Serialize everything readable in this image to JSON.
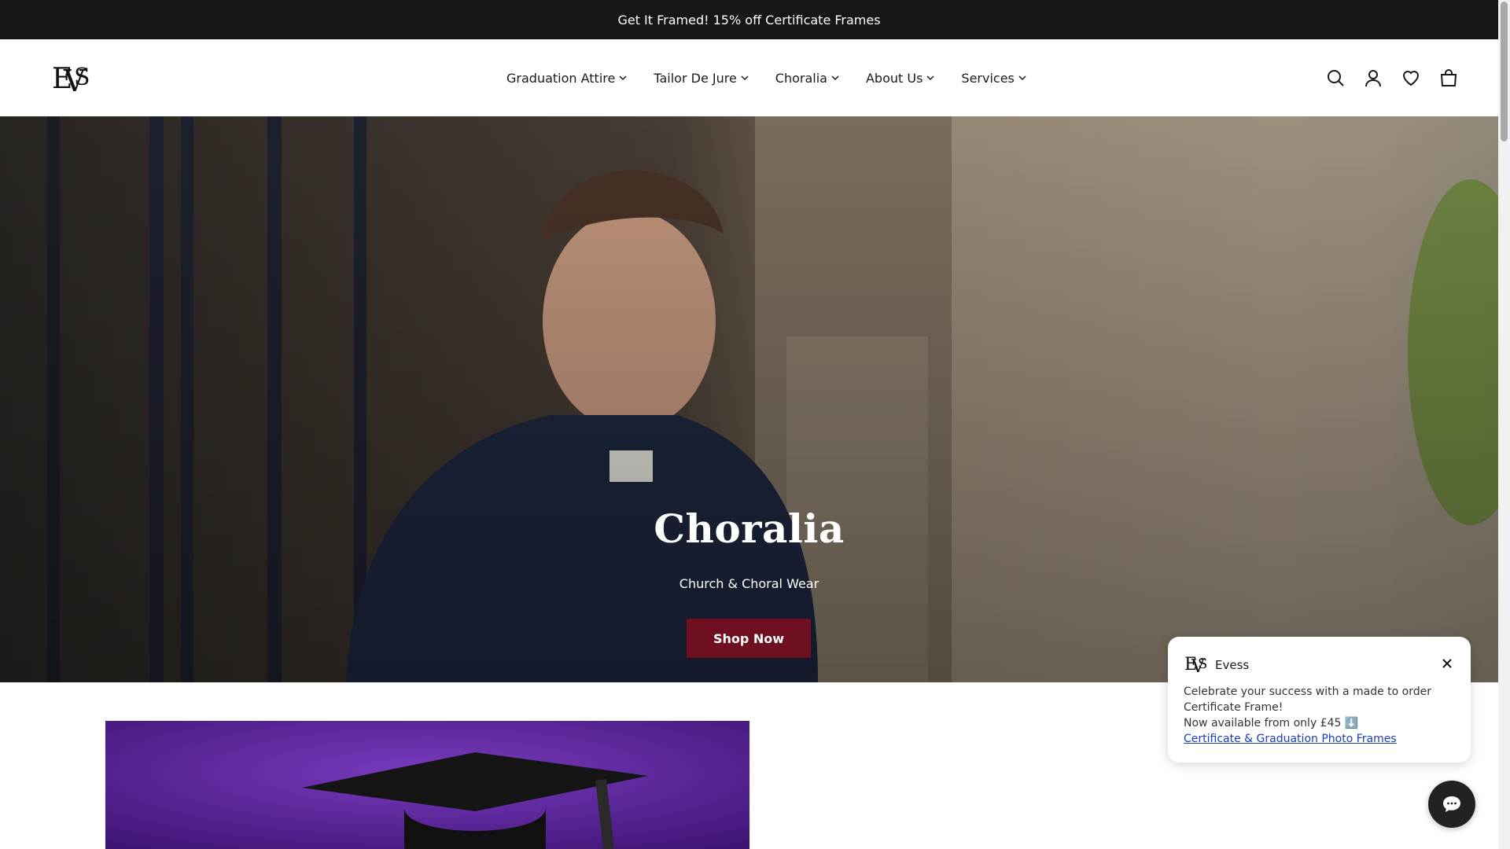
{
  "announcement": {
    "text": "Get It Framed! 15% off Certificate Frames"
  },
  "header": {
    "logo_text": "EVS",
    "nav": [
      {
        "label": "Graduation Attire"
      },
      {
        "label": "Tailor De Jure"
      },
      {
        "label": "Choralia"
      },
      {
        "label": "About Us"
      },
      {
        "label": "Services"
      }
    ],
    "icons": [
      "search-icon",
      "account-icon",
      "wishlist-heart-icon",
      "cart-bag-icon"
    ]
  },
  "hero": {
    "title": "Choralia",
    "subtitle": "Church & Choral Wear",
    "button_label": "Shop Now"
  },
  "popup": {
    "brand": "Evess",
    "line1": "Celebrate your success with a made to order Certificate Frame!",
    "line2": "Now available from only £45 ⬇️",
    "link": "Certificate & Graduation Photo Frames"
  },
  "colors": {
    "announcement_bg": "#161616",
    "button_bg": "#6e1020",
    "link": "#1a3fb3",
    "lower_image_bg": "#4b1a8a"
  }
}
